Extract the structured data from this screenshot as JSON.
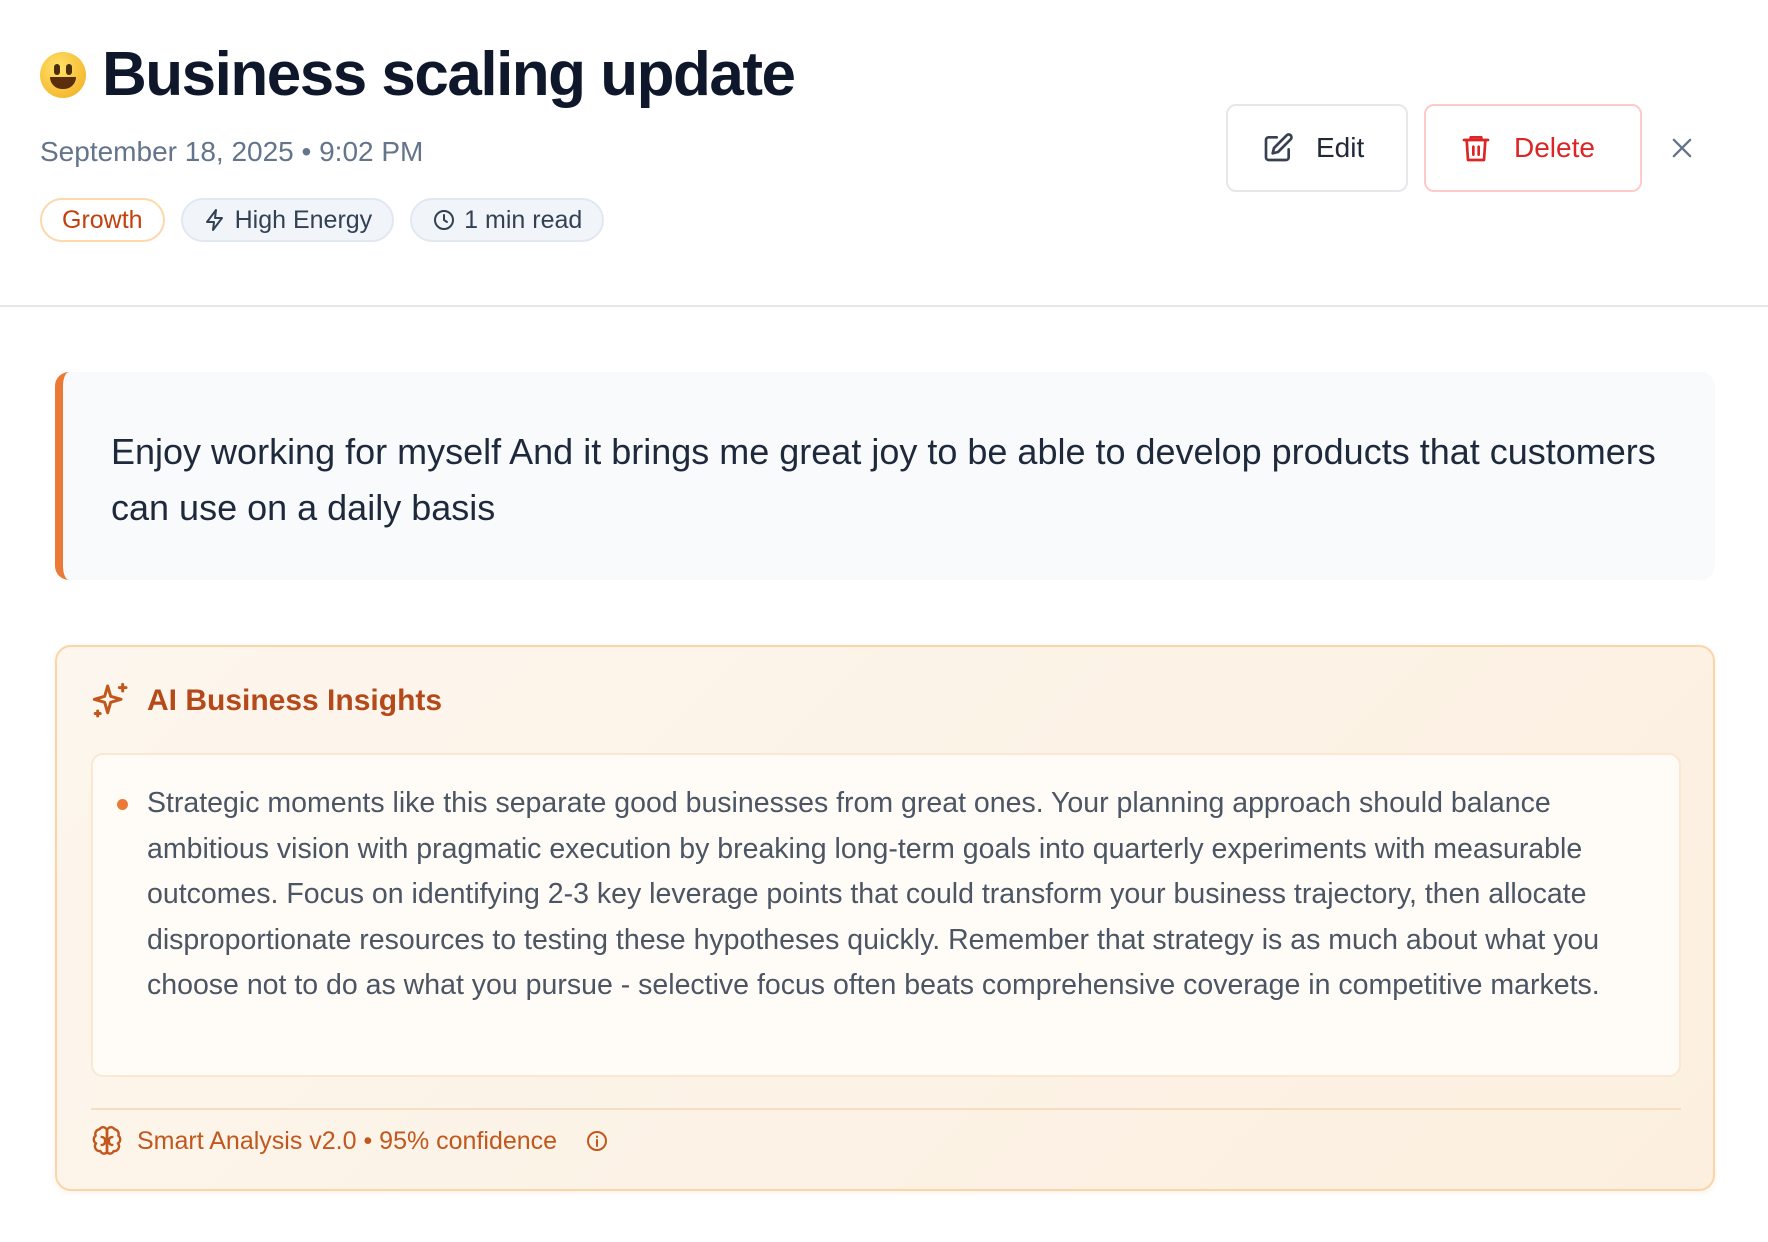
{
  "header": {
    "emoji": "😃",
    "title": "Business scaling update",
    "datetime": "September 18, 2025 • 9:02 PM",
    "tags": [
      {
        "label": "Growth",
        "icon": null
      },
      {
        "label": "High Energy",
        "icon": "lightning-icon"
      },
      {
        "label": "1 min read",
        "icon": "clock-icon"
      }
    ],
    "actions": {
      "edit_label": "Edit",
      "delete_label": "Delete"
    }
  },
  "entry": {
    "text": "Enjoy working for myself And it brings me great joy to be able to develop products that customers can use on a daily basis"
  },
  "insights": {
    "title": "AI Business Insights",
    "items": [
      "Strategic moments like this separate good businesses from great ones. Your planning approach should balance ambitious vision with pragmatic execution by breaking long-term goals into quarterly experiments with measurable outcomes. Focus on identifying 2-3 key leverage points that could transform your business trajectory, then allocate disproportionate resources to testing these hypotheses quickly. Remember that strategy is as much about what you choose not to do as what you pursue - selective focus often beats comprehensive coverage in competitive markets."
    ],
    "footer": "Smart Analysis v2.0 • 95% confidence"
  },
  "colors": {
    "accent": "#ea7a35",
    "danger": "#dc2626",
    "insight_title": "#b4491a"
  }
}
